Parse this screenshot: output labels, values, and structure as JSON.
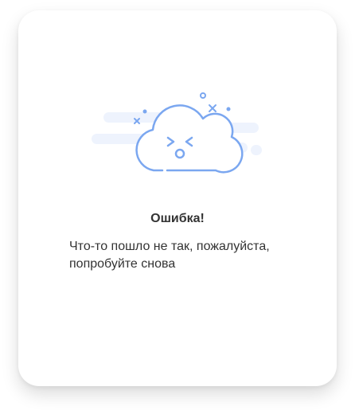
{
  "error_dialog": {
    "icon": "sad-cloud-icon",
    "title": "Ошибка!",
    "message": "Что-то пошло не так, пожалуйста, попробуйте снова"
  },
  "colors": {
    "icon_stroke": "#7BA7F0",
    "icon_fill": "#FFFFFF",
    "backdrop_stripe": "#EEF3FD",
    "text": "#333333",
    "card_background": "#FFFFFF"
  }
}
